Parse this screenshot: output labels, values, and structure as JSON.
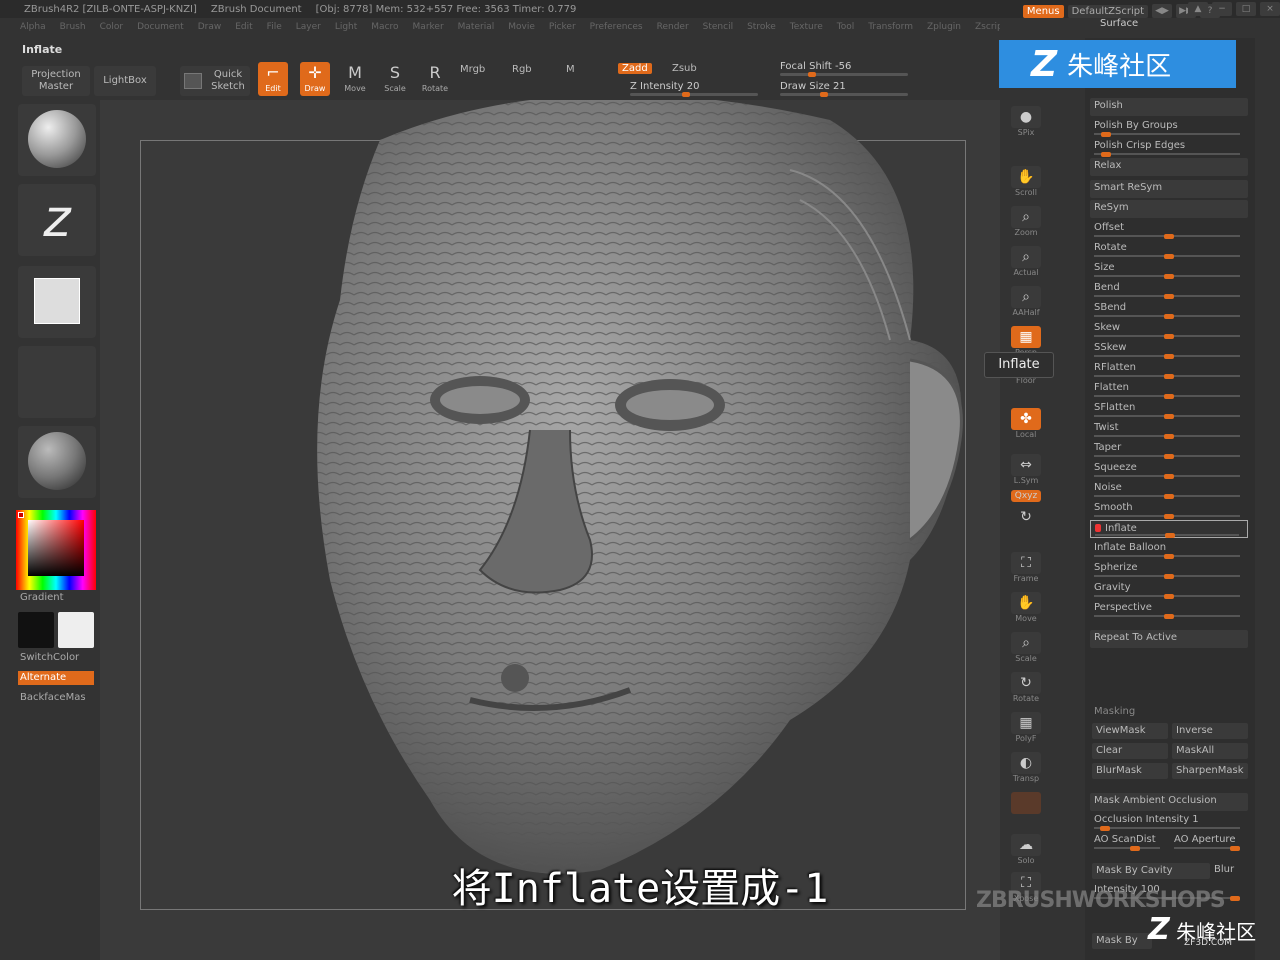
{
  "titlebar": {
    "app": "ZBrush4R2 [ZILB-ONTE-ASPJ-KNZI]",
    "doc": "ZBrush Document",
    "stats": "[Obj: 8778] Mem: 532+557 Free: 3563 Timer: 0.779",
    "menus_btn": "Menus",
    "script_btn": "DefaultZScript"
  },
  "menubar": [
    "Alpha",
    "Brush",
    "Color",
    "Document",
    "Draw",
    "Edit",
    "File",
    "Layer",
    "Light",
    "Macro",
    "Marker",
    "Material",
    "Movie",
    "Picker",
    "Preferences",
    "Render",
    "Stencil",
    "Stroke",
    "Texture",
    "Tool",
    "Transform",
    "Zplugin",
    "Zscript"
  ],
  "brush_name": "Inflate",
  "toolbar": {
    "projection_master": "Projection Master",
    "lightbox": "LightBox",
    "quick_sketch": "Quick Sketch",
    "edit": "Edit",
    "draw": "Draw",
    "move": "Move",
    "scale": "Scale",
    "rotate": "Rotate",
    "mrgb": "Mrgb",
    "rgb": "Rgb",
    "m": "M",
    "zadd": "Zadd",
    "zsub": "Zsub",
    "zintensity": "Z Intensity 20",
    "focal_shift": "Focal Shift -56",
    "draw_size": "Draw Size 21"
  },
  "leftshelf": {
    "gradient": "Gradient",
    "switchcolor": "SwitchColor",
    "alternate": "Alternate",
    "backface": "BackfaceMas"
  },
  "rightshelf": {
    "spix": "SPix",
    "scroll": "Scroll",
    "zoom": "Zoom",
    "actual": "Actual",
    "aahalf": "AAHalf",
    "persp": "Persp",
    "floor": "Floor",
    "local": "Local",
    "lsym": "L.Sym",
    "xyz": "Qxyz",
    "frame": "Frame",
    "move": "Move",
    "scale": "Scale",
    "rotate": "Rotate",
    "polyf": "PolyF",
    "transp": "Transp",
    "solo": "Solo",
    "xpose": "Xpose",
    "tooltip": "Inflate"
  },
  "panel": {
    "title": "Surface",
    "items": [
      {
        "label": "Polish",
        "type": "btn"
      },
      {
        "label": "Polish By Groups",
        "type": "slider",
        "pos": 0.05
      },
      {
        "label": "Polish Crisp Edges",
        "type": "slider",
        "pos": 0.05
      },
      {
        "label": "Relax",
        "type": "btn"
      },
      {
        "label": "Smart ReSym",
        "type": "btn"
      },
      {
        "label": "ReSym",
        "type": "btn"
      },
      {
        "label": "Offset",
        "type": "slider",
        "pos": 0.5
      },
      {
        "label": "Rotate",
        "type": "slider",
        "pos": 0.5
      },
      {
        "label": "Size",
        "type": "slider",
        "pos": 0.5
      },
      {
        "label": "Bend",
        "type": "slider",
        "pos": 0.5
      },
      {
        "label": "SBend",
        "type": "slider",
        "pos": 0.5
      },
      {
        "label": "Skew",
        "type": "slider",
        "pos": 0.5
      },
      {
        "label": "SSkew",
        "type": "slider",
        "pos": 0.5
      },
      {
        "label": "RFlatten",
        "type": "slider",
        "pos": 0.5
      },
      {
        "label": "Flatten",
        "type": "slider",
        "pos": 0.5
      },
      {
        "label": "SFlatten",
        "type": "slider",
        "pos": 0.5
      },
      {
        "label": "Twist",
        "type": "slider",
        "pos": 0.5
      },
      {
        "label": "Taper",
        "type": "slider",
        "pos": 0.5
      },
      {
        "label": "Squeeze",
        "type": "slider",
        "pos": 0.5
      },
      {
        "label": "Noise",
        "type": "slider",
        "pos": 0.5
      },
      {
        "label": "Smooth",
        "type": "slider",
        "pos": 0.5
      },
      {
        "label": "Inflate",
        "type": "selected",
        "pos": 0.5
      },
      {
        "label": "Inflate Balloon",
        "type": "slider",
        "pos": 0.5
      },
      {
        "label": "Spherize",
        "type": "slider",
        "pos": 0.5
      },
      {
        "label": "Gravity",
        "type": "slider",
        "pos": 0.5
      },
      {
        "label": "Perspective",
        "type": "slider",
        "pos": 0.5
      }
    ],
    "repeat_active": "Repeat To Active",
    "masking": "Masking",
    "viewmask": "ViewMask",
    "inverse": "Inverse",
    "clear": "Clear",
    "maskall": "MaskAll",
    "blurmask": "BlurMask",
    "sharpenmask": "SharpenMask",
    "mask_ao": "Mask Ambient Occlusion",
    "occlusion_intensity": "Occlusion Intensity 1",
    "ao_scandist": "AO ScanDist",
    "ao_aperture": "AO Aperture",
    "mask_by_cavity": "Mask By Cavity",
    "blur": "Blur",
    "intensity": "Intensity 100",
    "mask_by": "Mask By"
  },
  "overlay": {
    "logo_text": "朱峰社区",
    "subtitle": "将Inflate设置成-1",
    "zbrush_workshops": "ZBRUSHWORKSHOPS",
    "watermark": "朱峰社区",
    "watermark_sub": "ZF3D.COM"
  }
}
